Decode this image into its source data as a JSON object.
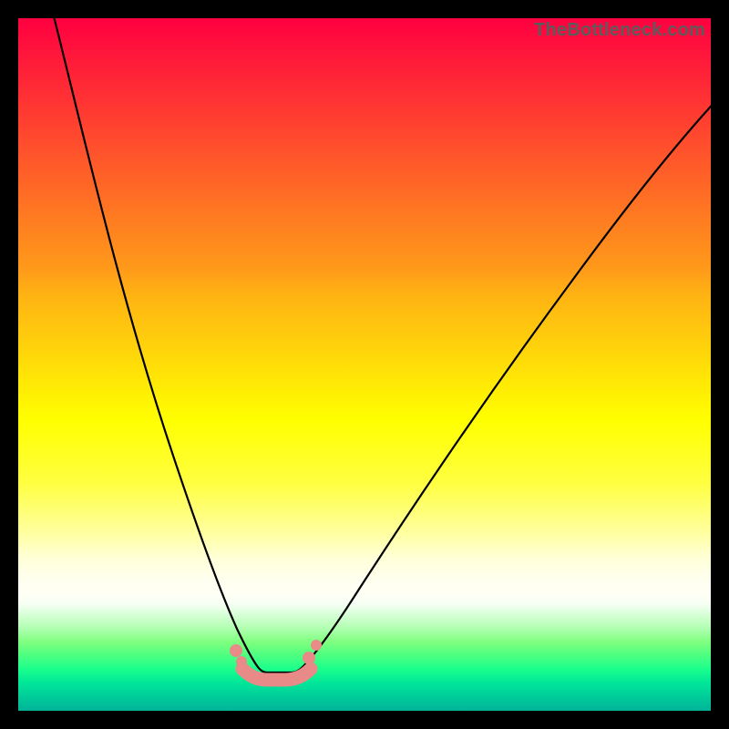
{
  "watermark": "TheBottleneck.com",
  "chart_data": {
    "type": "line",
    "title": "",
    "xlabel": "",
    "ylabel": "",
    "xlim": [
      0,
      100
    ],
    "ylim": [
      0,
      100
    ],
    "grid": false,
    "legend": false,
    "notes": "Background is a vertical gradient from red (top, high bottleneck) through orange/yellow to green (bottom, near-zero bottleneck). A black V-shaped curve has a flat minimum around x≈33–40. A muted pink segment with dots sits at the valley bottom.",
    "series": [
      {
        "name": "main-curve",
        "x": [
          0,
          5,
          10,
          15,
          20,
          25,
          28,
          31,
          33,
          35,
          37,
          40,
          43,
          47,
          52,
          58,
          65,
          73,
          82,
          92,
          100
        ],
        "y": [
          103,
          92,
          78,
          63,
          47,
          31,
          21,
          11,
          4,
          1,
          0.5,
          1,
          4,
          10,
          19,
          30,
          43,
          55,
          67,
          78,
          86
        ]
      },
      {
        "name": "valley-highlight",
        "x": [
          31,
          33,
          35,
          37,
          40
        ],
        "y": [
          3,
          1,
          0.5,
          1,
          2.5
        ]
      }
    ]
  }
}
